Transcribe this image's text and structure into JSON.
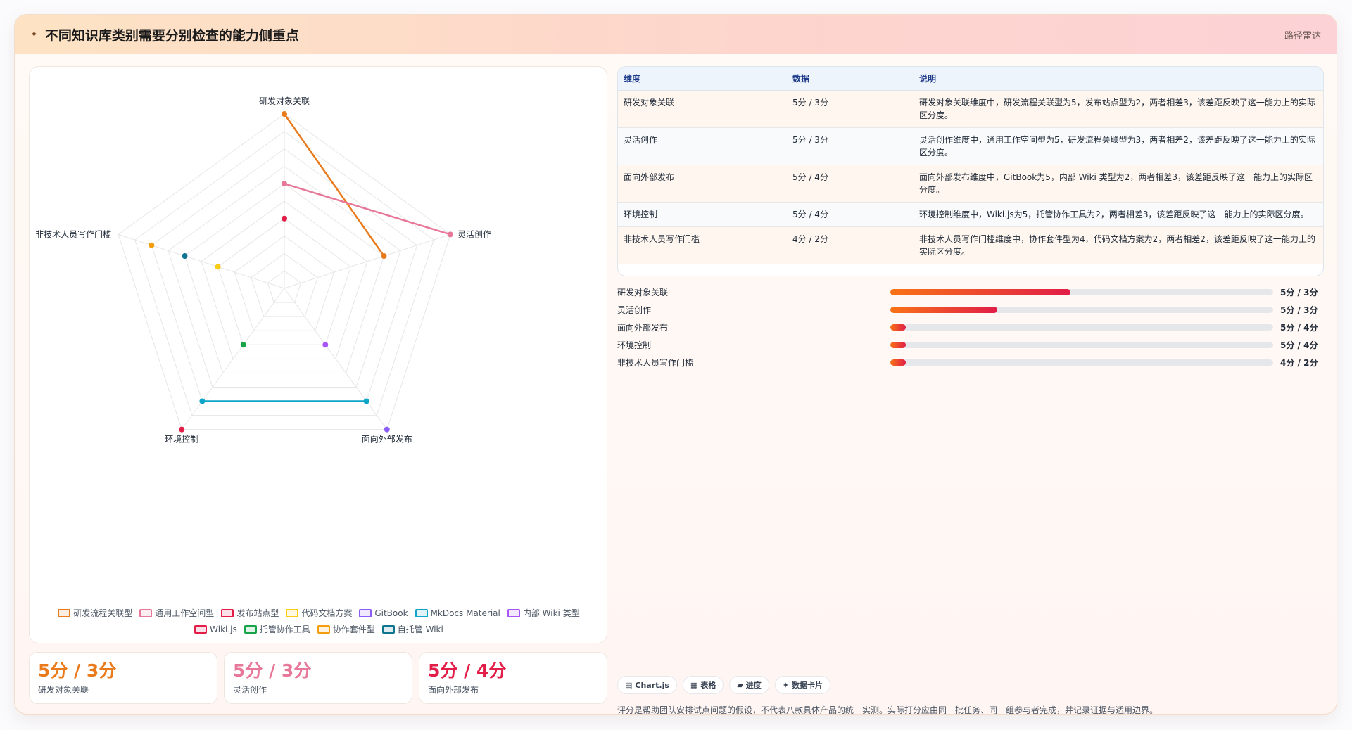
{
  "header": {
    "icon": "sparkle-icon",
    "title": "不同知识库类别需要分别检查的能力侧重点",
    "tag": "路径雷达"
  },
  "chart_data": {
    "type": "radar",
    "axes": [
      "研发对象关联",
      "灵活创作",
      "面向外部发布",
      "环境控制",
      "非技术人员写作门槛"
    ],
    "rmax": 5,
    "rings": 10,
    "series": [
      {
        "name": "研发流程关联型",
        "color": "#ea7b1c",
        "values": [
          5,
          3,
          null,
          null,
          null
        ]
      },
      {
        "name": "通用工作空间型",
        "color": "#e8789a",
        "values": [
          3,
          5,
          null,
          null,
          null
        ]
      },
      {
        "name": "发布站点型",
        "color": "#e11d48",
        "values": [
          2,
          null,
          null,
          null,
          null
        ]
      },
      {
        "name": "代码文档方案",
        "color": "#facc15",
        "values": [
          null,
          null,
          null,
          null,
          2
        ]
      },
      {
        "name": "GitBook",
        "color": "#8b5cf6",
        "values": [
          null,
          null,
          5,
          null,
          null
        ]
      },
      {
        "name": "MkDocs Material",
        "color": "#0ea5c9",
        "values": [
          null,
          null,
          4,
          4,
          null
        ]
      },
      {
        "name": "内部 Wiki 类型",
        "color": "#a855f7",
        "values": [
          null,
          null,
          2,
          null,
          null
        ]
      },
      {
        "name": "Wiki.js",
        "color": "#e11d48",
        "values": [
          null,
          null,
          null,
          5,
          null
        ]
      },
      {
        "name": "托管协作工具",
        "color": "#16a34a",
        "values": [
          null,
          null,
          null,
          2,
          null
        ]
      },
      {
        "name": "协作套件型",
        "color": "#f59e0b",
        "values": [
          null,
          null,
          null,
          null,
          4
        ]
      },
      {
        "name": "自托管 Wiki",
        "color": "#0e7490",
        "values": [
          null,
          null,
          null,
          null,
          3
        ]
      }
    ]
  },
  "stats": [
    {
      "value": "5分 / 3分",
      "label": "研发对象关联",
      "color": "#ea7b1c"
    },
    {
      "value": "5分 / 3分",
      "label": "灵活创作",
      "color": "#e8789a"
    },
    {
      "value": "5分 / 4分",
      "label": "面向外部发布",
      "color": "#e11d48"
    }
  ],
  "table": {
    "headers": [
      "维度",
      "数据",
      "说明"
    ],
    "rows": [
      [
        "研发对象关联",
        "5分 / 3分",
        "研发对象关联维度中，研发流程关联型为5，发布站点型为2，两者相差3，该差距反映了这一能力上的实际区分度。"
      ],
      [
        "灵活创作",
        "5分 / 3分",
        "灵活创作维度中，通用工作空间型为5，研发流程关联型为3，两者相差2，该差距反映了这一能力上的实际区分度。"
      ],
      [
        "面向外部发布",
        "5分 / 4分",
        "面向外部发布维度中，GitBook为5，内部 Wiki 类型为2，两者相差3，该差距反映了这一能力上的实际区分度。"
      ],
      [
        "环境控制",
        "5分 / 4分",
        "环境控制维度中，Wiki.js为5，托管协作工具为2，两者相差3，该差距反映了这一能力上的实际区分度。"
      ],
      [
        "非技术人员写作门槛",
        "4分 / 2分",
        "非技术人员写作门槛维度中，协作套件型为4，代码文档方案为2，两者相差2，该差距反映了这一能力上的实际区分度。"
      ]
    ]
  },
  "bars": [
    {
      "label": "研发对象关联",
      "value": "5分 / 3分",
      "fill": 0.47
    },
    {
      "label": "灵活创作",
      "value": "5分 / 3分",
      "fill": 0.28
    },
    {
      "label": "面向外部发布",
      "value": "5分 / 4分",
      "fill": 0.04
    },
    {
      "label": "环境控制",
      "value": "5分 / 4分",
      "fill": 0.04
    },
    {
      "label": "非技术人员写作门槛",
      "value": "4分 / 2分",
      "fill": 0.04
    }
  ],
  "chips": [
    {
      "icon": "chart-icon",
      "glyph": "▤",
      "label": "Chart.js"
    },
    {
      "icon": "table-icon",
      "glyph": "▦",
      "label": "表格"
    },
    {
      "icon": "progress-icon",
      "glyph": "▰",
      "label": "进度"
    },
    {
      "icon": "card-icon",
      "glyph": "✦",
      "label": "数据卡片"
    }
  ],
  "note": "评分是帮助团队安排试点问题的假设，不代表八款具体产品的统一实测。实际打分应由同一批任务、同一组参与者完成，并记录证据与适用边界。"
}
